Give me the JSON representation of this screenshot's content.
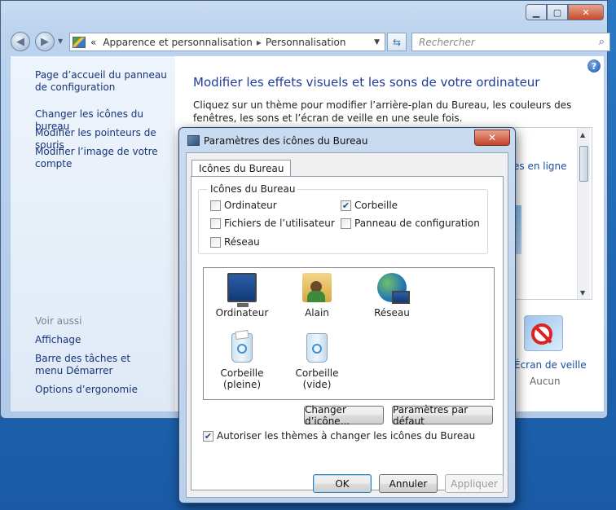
{
  "window": {
    "caption": {
      "minimize": "▁",
      "maximize": "▢",
      "close": "✕"
    },
    "address": {
      "prefix": "«",
      "crumb1": "Apparence et personnalisation",
      "separator": "▸",
      "crumb2": "Personnalisation"
    },
    "search_placeholder": "Rechercher"
  },
  "sidebar": {
    "home_link": "Page d’accueil du panneau de configuration",
    "links": [
      "Changer les icônes du bureau",
      "Modifier les pointeurs de souris",
      "Modifier l’image de votre compte"
    ],
    "see_also_label": "Voir aussi",
    "see_also": [
      "Affichage",
      "Barre des tâches et menu Démarrer",
      "Options d’ergonomie"
    ]
  },
  "content": {
    "title": "Modifier les effets visuels et les sons de votre ordinateur",
    "description": "Cliquez sur un thème pour modifier l’arrière-plan du Bureau, les couleurs des fenêtres, les sons et l’écran de veille en une seule fois.",
    "online_link_fragment": "es en ligne",
    "screensaver_label": "Écran de veille",
    "screensaver_value": "Aucun"
  },
  "dialog": {
    "title": "Paramètres des icônes du Bureau",
    "close": "✕",
    "tab": "Icônes du Bureau",
    "group_title": "Icônes du Bureau",
    "checkboxes": [
      {
        "label": "Ordinateur",
        "checked": false
      },
      {
        "label": "Fichiers de l’utilisateur",
        "checked": false
      },
      {
        "label": "Réseau",
        "checked": false
      },
      {
        "label": "Corbeille",
        "checked": true
      },
      {
        "label": "Panneau de configuration",
        "checked": false
      }
    ],
    "icons": [
      {
        "label": "Ordinateur",
        "icon": "computer-icon"
      },
      {
        "label": "Alain",
        "icon": "user-folder-icon"
      },
      {
        "label": "Réseau",
        "icon": "network-icon"
      },
      {
        "label": "Corbeille (pleine)",
        "icon": "recycle-bin-full-icon"
      },
      {
        "label": "Corbeille (vide)",
        "icon": "recycle-bin-empty-icon"
      }
    ],
    "change_icon_button": "Changer d’icône...",
    "defaults_button": "Paramètres par défaut",
    "allow_themes": {
      "label": "Autoriser les thèmes à changer les icônes du Bureau",
      "checked": true
    },
    "ok": "OK",
    "cancel": "Annuler",
    "apply": "Appliquer"
  }
}
